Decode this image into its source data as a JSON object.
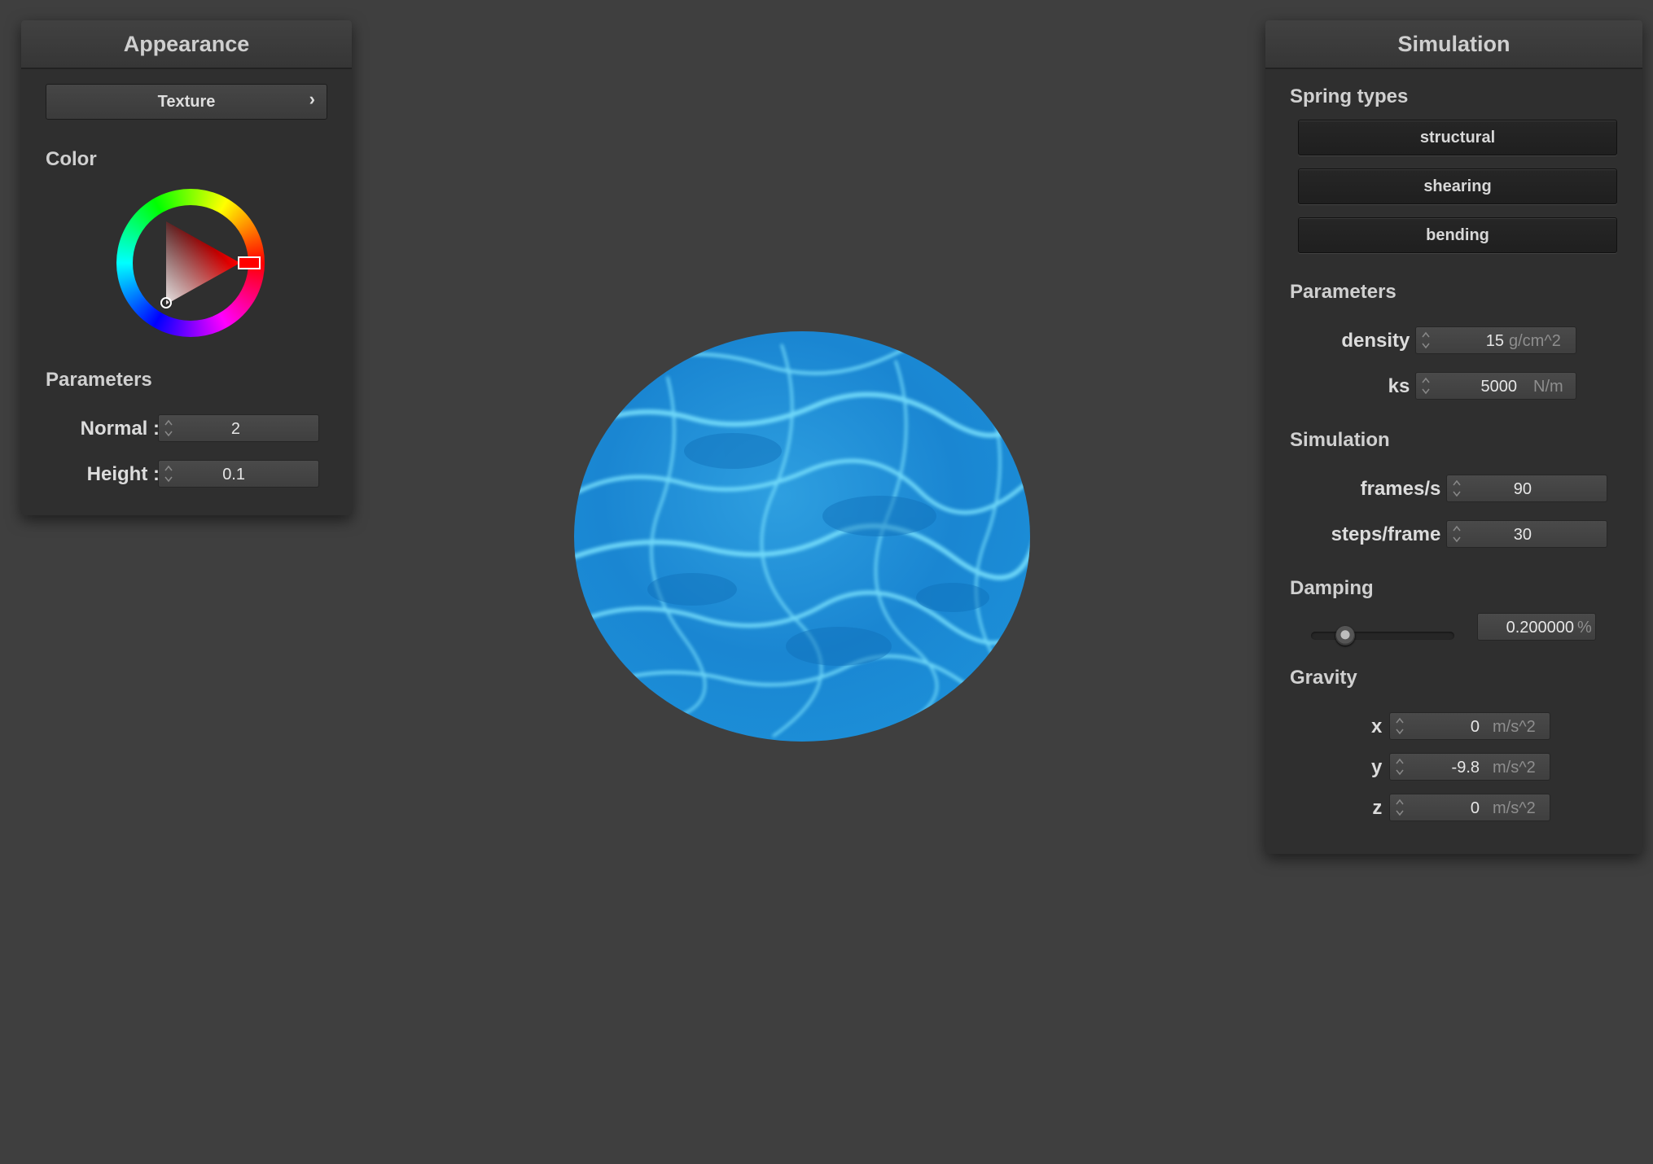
{
  "appearance": {
    "title": "Appearance",
    "texture_button": "Texture",
    "texture_chevron": "›",
    "color_label": "Color",
    "color_selected": "#ff0000",
    "parameters_label": "Parameters",
    "normal_label": "Normal :",
    "normal_value": "2",
    "height_label": "Height :",
    "height_value": "0.1"
  },
  "simulation_panel": {
    "title": "Simulation",
    "spring_types_label": "Spring types",
    "spring_types": [
      "structural",
      "shearing",
      "bending"
    ],
    "parameters_label": "Parameters",
    "density_label": "density :",
    "density_value": "15",
    "density_unit": "g/cm^2",
    "ks_label": "ks :",
    "ks_value": "5000",
    "ks_unit": "N/m",
    "simulation_label": "Simulation",
    "fps_label": "frames/s :",
    "fps_value": "90",
    "steps_label": "steps/frame :",
    "steps_value": "30",
    "damping_label": "Damping",
    "damping_fraction": 0.2,
    "damping_value": "0.200000",
    "damping_unit": "%",
    "gravity_label": "Gravity",
    "gx_label": "x :",
    "gx_value": "0",
    "gy_label": "y :",
    "gy_value": "-9.8",
    "gz_label": "z :",
    "gz_value": "0",
    "gravity_unit": "m/s^2"
  },
  "viewport": {
    "object": "water-textured sphere"
  }
}
